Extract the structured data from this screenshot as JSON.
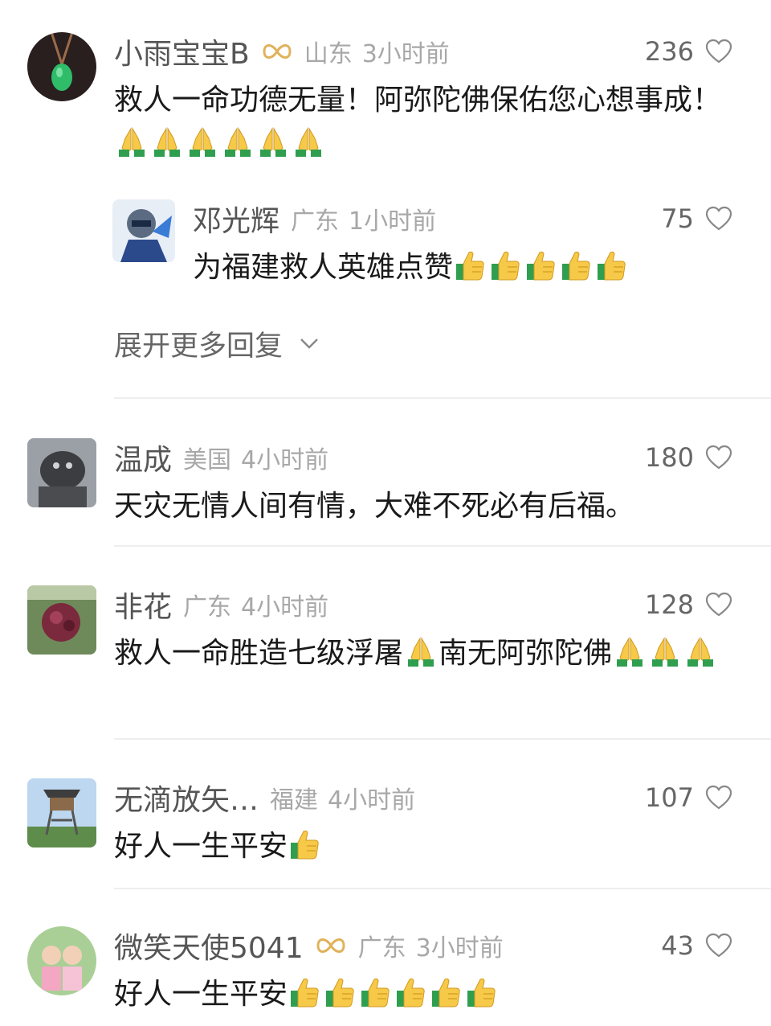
{
  "comments": [
    {
      "name": "小雨宝宝B",
      "location": "山东",
      "time": "3小时前",
      "likes": "236",
      "text": "救人一命功德无量！阿弥陀佛保佑您心想事成！",
      "emoji": "pray",
      "emoji_count": 6,
      "avatar_icon": "jade-pendant-avatar",
      "badge_icon": "infinity-badge-icon",
      "replies": [
        {
          "name": "邓光辉",
          "location": "广东",
          "time": "1小时前",
          "likes": "75",
          "text": "为福建救人英雄点赞",
          "emoji": "thumbs-up",
          "emoji_count": 5,
          "avatar_icon": "cartoon-character-avatar"
        }
      ],
      "expand_label": "展开更多回复"
    },
    {
      "name": "温成",
      "location": "美国",
      "time": "4小时前",
      "likes": "180",
      "text": "天灾无情人间有情，大难不死必有后福。",
      "avatar_icon": "stone-lion-avatar"
    },
    {
      "name": "非花",
      "location": "广东",
      "time": "4小时前",
      "likes": "128",
      "text_part1": "救人一命胜造七级浮屠",
      "text_part2": "南无阿弥陀佛",
      "emoji": "pray",
      "avatar_icon": "flower-avatar"
    },
    {
      "name": "无滴放矢…",
      "location": "福建",
      "time": "4小时前",
      "likes": "107",
      "text": "好人一生平安",
      "emoji": "thumbs-up",
      "emoji_count": 1,
      "avatar_icon": "watchtower-avatar"
    },
    {
      "name": "微笑天使5041",
      "location": "广东",
      "time": "3小时前",
      "likes": "43",
      "text": "好人一生平安",
      "emoji": "thumbs-up",
      "emoji_count": 6,
      "avatar_icon": "child-photo-avatar",
      "badge_icon": "infinity-badge-icon"
    }
  ],
  "colors": {
    "name": "#555555",
    "meta": "#a8a8a8",
    "text": "#1a1a1a",
    "divider": "#eeeeee",
    "badge": "#e0b25a"
  }
}
